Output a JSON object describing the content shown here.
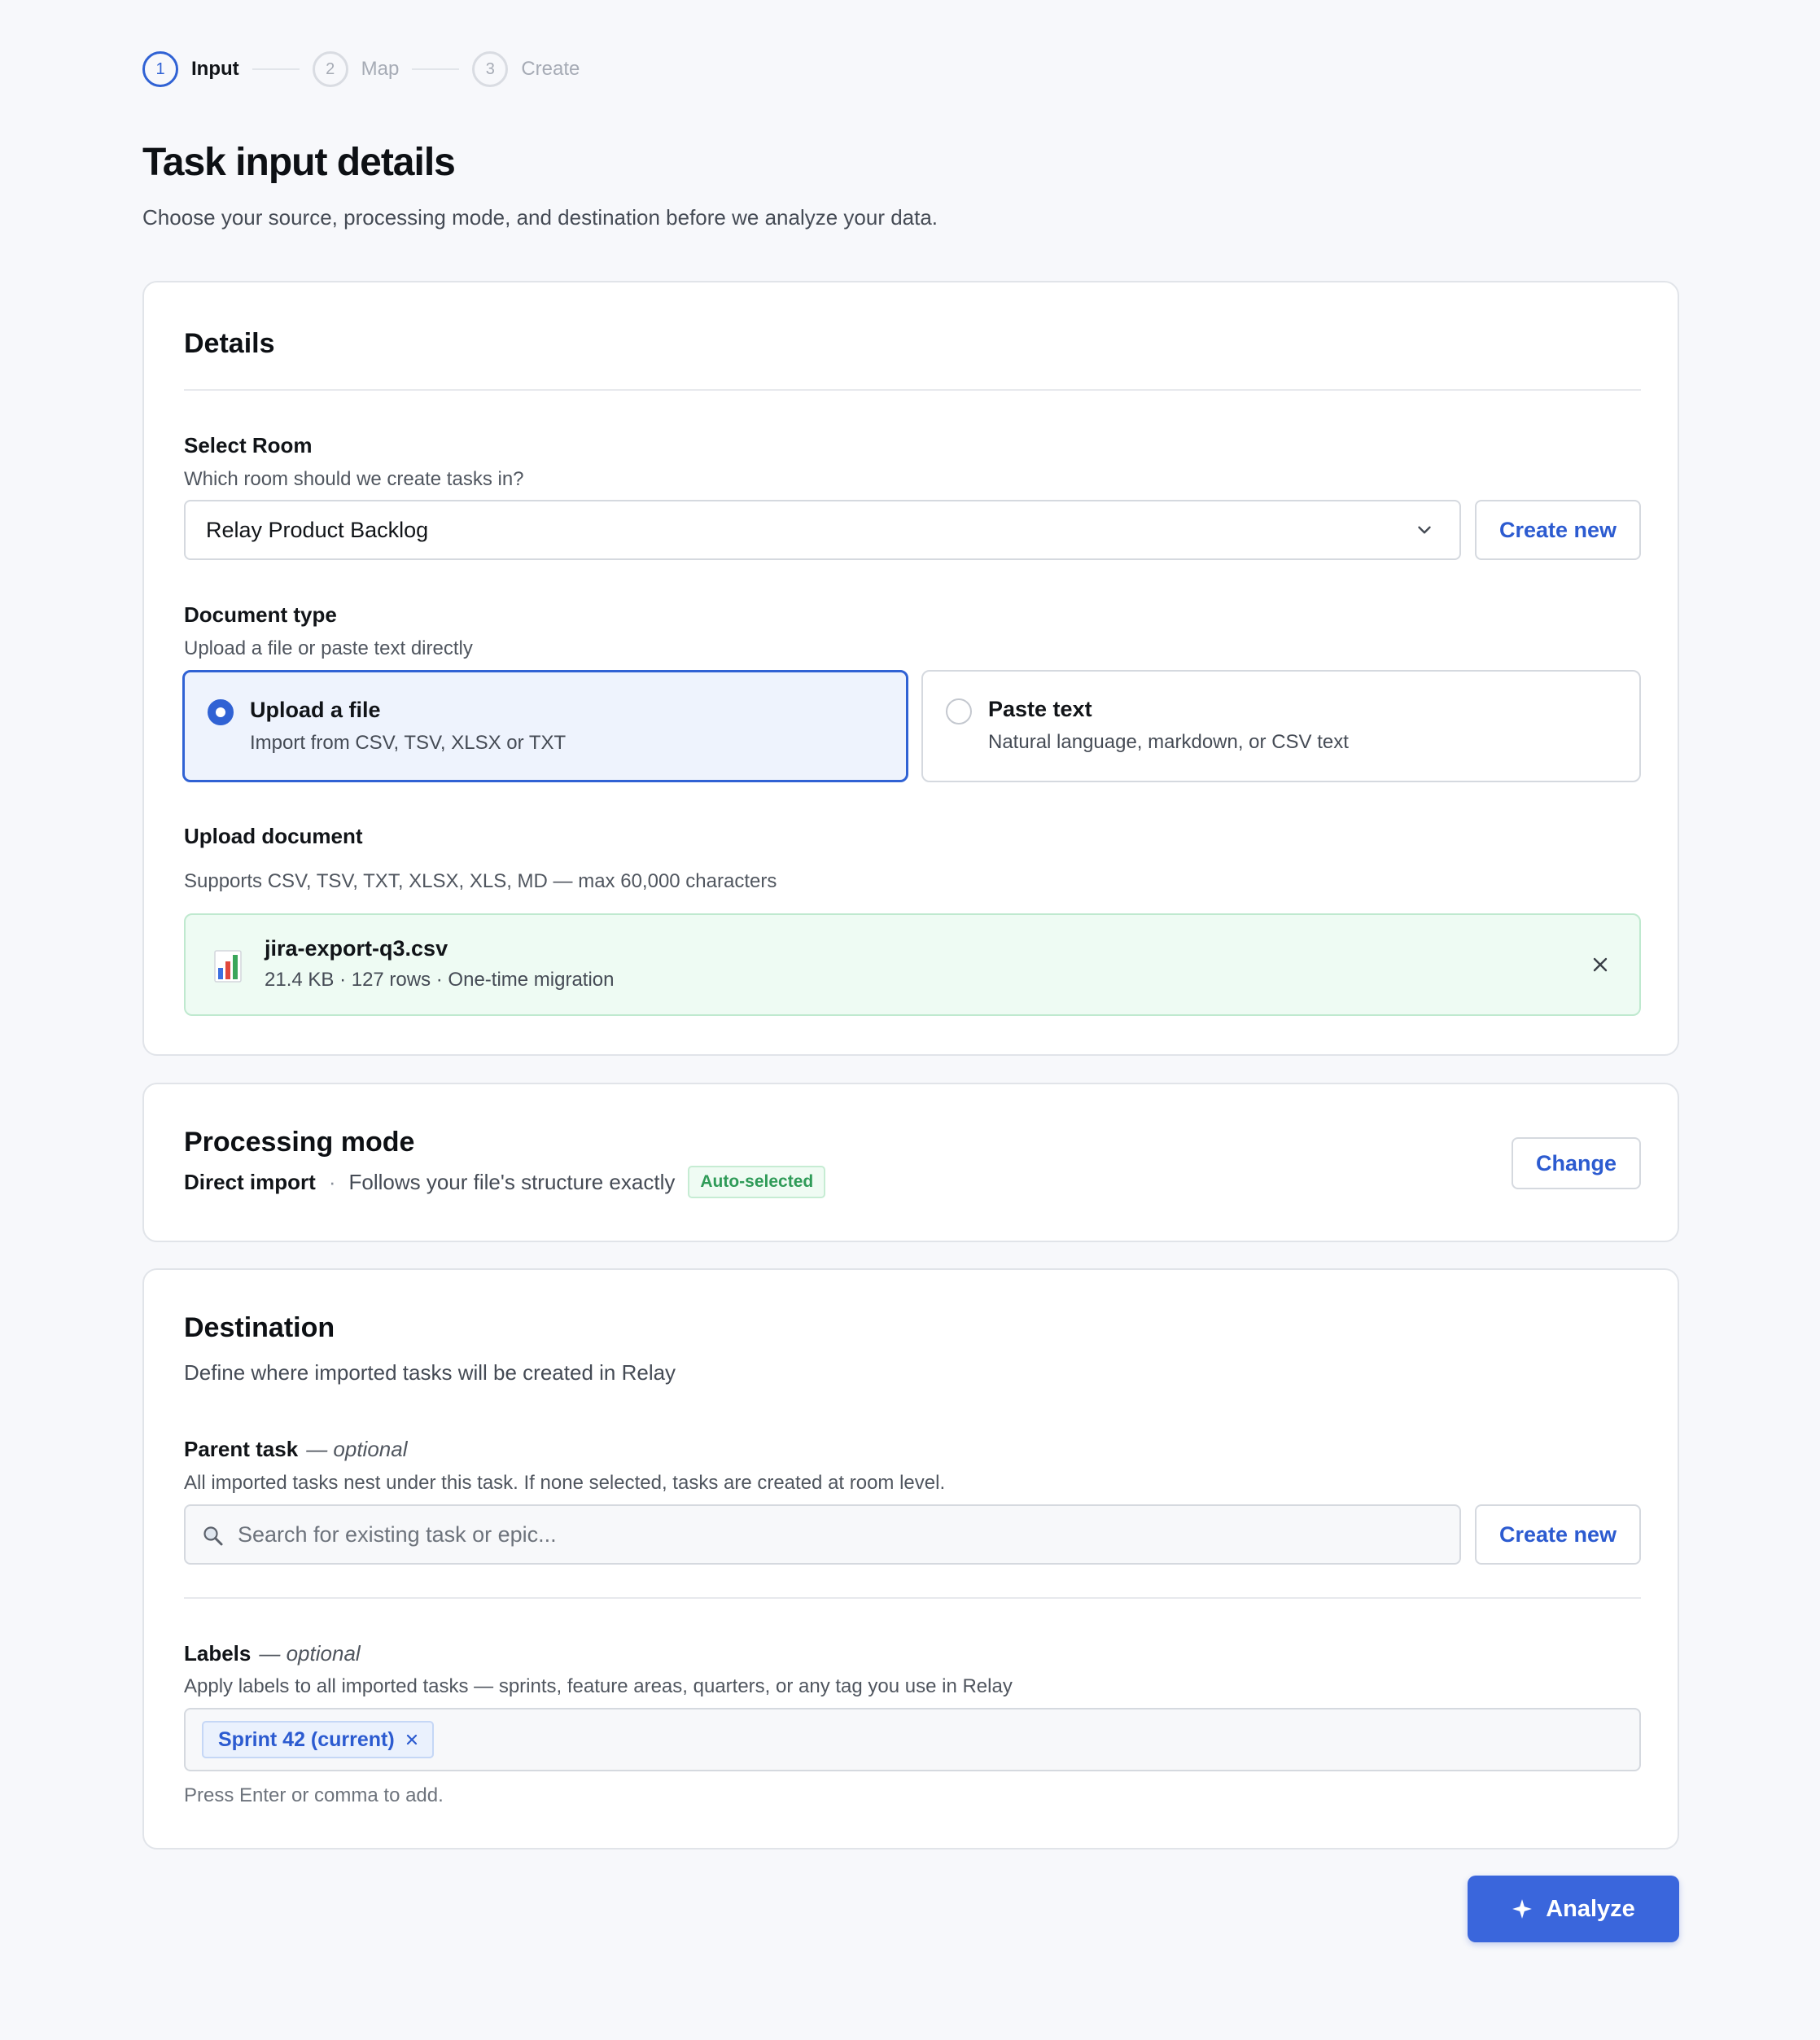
{
  "stepper": {
    "steps": [
      {
        "number": "1",
        "label": "Input",
        "state": "active"
      },
      {
        "number": "2",
        "label": "Map",
        "state": "pending"
      },
      {
        "number": "3",
        "label": "Create",
        "state": "pending"
      }
    ]
  },
  "header": {
    "title": "Task input details",
    "subtitle": "Choose your source, processing mode, and destination before we analyze your data."
  },
  "details": {
    "title": "Details",
    "room": {
      "label": "Select Room",
      "help": "Which room should we create tasks in?",
      "selected_value": "Relay Product Backlog",
      "create_button": "Create new"
    },
    "doc_type": {
      "label": "Document type",
      "help": "Upload a file or paste text directly",
      "options": [
        {
          "title": "Upload a file",
          "desc": "Import from CSV, TSV, XLSX or TXT",
          "selected": true
        },
        {
          "title": "Paste text",
          "desc": "Natural language, markdown, or CSV text",
          "selected": false
        }
      ]
    },
    "upload": {
      "label": "Upload document",
      "help": "Supports CSV, TSV, TXT, XLSX, XLS, MD — max 60,000 characters",
      "file": {
        "name": "jira-export-q3.csv",
        "meta": "21.4 KB · 127 rows · One-time migration",
        "icon": "bar-chart-icon"
      }
    }
  },
  "processing": {
    "title": "Processing mode",
    "mode": "Direct import",
    "separator": "·",
    "description": "Follows your file's structure exactly",
    "badge": "Auto-selected",
    "change_button": "Change"
  },
  "destination": {
    "title": "Destination",
    "subtitle": "Define where imported tasks will be created in Relay",
    "parent_task": {
      "label": "Parent task",
      "optional": "— optional",
      "help": "All imported tasks nest under this task. If none selected, tasks are created at room level.",
      "placeholder": "Search for existing task or epic...",
      "create_button": "Create new"
    },
    "labels": {
      "label": "Labels",
      "optional": "— optional",
      "help": "Apply labels to all imported tasks — sprints, feature areas, quarters, or any tag you use in Relay",
      "tags": [
        "Sprint 42 (current)"
      ],
      "hint": "Press Enter or comma to add."
    }
  },
  "actions": {
    "analyze_label": "Analyze"
  },
  "colors": {
    "accent": "#3062d4",
    "success_bg": "#eefbf3",
    "success_text": "#2f9b58",
    "page_bg": "#f7f8fb"
  }
}
